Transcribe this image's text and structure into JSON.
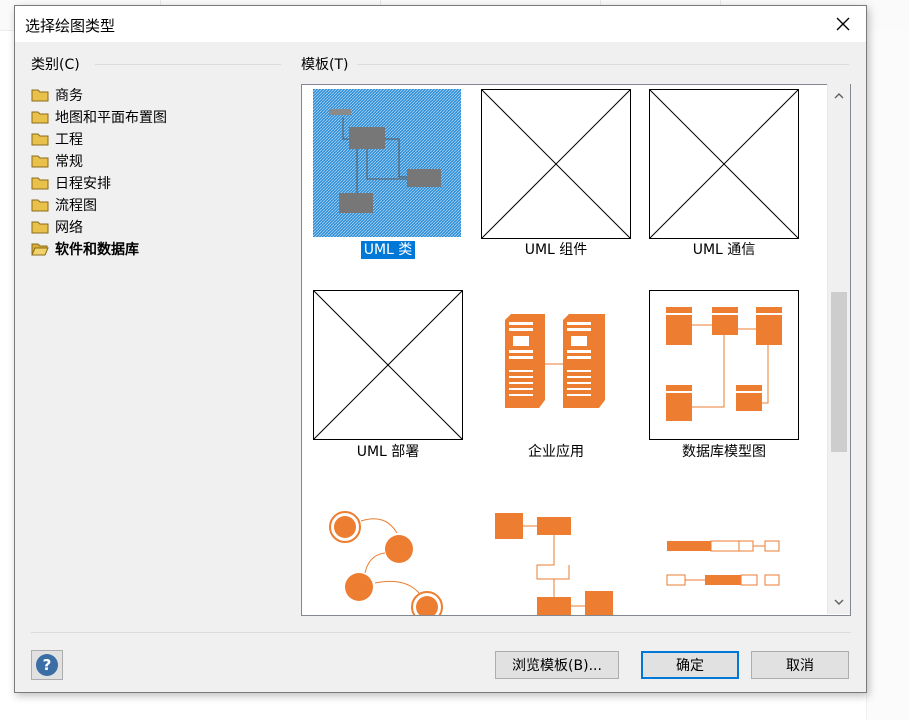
{
  "dialog": {
    "title": "选择绘图类型",
    "close_icon": "close-icon"
  },
  "categories": {
    "label": "类别(C)",
    "items": [
      {
        "label": "商务",
        "selected": false
      },
      {
        "label": "地图和平面布置图",
        "selected": false
      },
      {
        "label": "工程",
        "selected": false
      },
      {
        "label": "常规",
        "selected": false
      },
      {
        "label": "日程安排",
        "selected": false
      },
      {
        "label": "流程图",
        "selected": false
      },
      {
        "label": "网络",
        "selected": false
      },
      {
        "label": "软件和数据库",
        "selected": true
      }
    ]
  },
  "templates": {
    "label": "模板(T)",
    "items": [
      {
        "label": "UML 类",
        "selected": true,
        "thumb": "uml-class-thumbnail"
      },
      {
        "label": "UML 组件",
        "selected": false,
        "thumb": "placeholder-thumbnail"
      },
      {
        "label": "UML 通信",
        "selected": false,
        "thumb": "placeholder-thumbnail"
      },
      {
        "label": "UML 部署",
        "selected": false,
        "thumb": "placeholder-thumbnail"
      },
      {
        "label": "企业应用",
        "selected": false,
        "thumb": "servers-thumbnail"
      },
      {
        "label": "数据库模型图",
        "selected": false,
        "thumb": "database-model-thumbnail"
      },
      {
        "label": "",
        "selected": false,
        "thumb": "state-machine-thumbnail"
      },
      {
        "label": "",
        "selected": false,
        "thumb": "flow-thumbnail"
      },
      {
        "label": "",
        "selected": false,
        "thumb": "sequence-thumbnail"
      }
    ]
  },
  "buttons": {
    "browse": "浏览模板(B)...",
    "ok": "确定",
    "cancel": "取消",
    "help_icon": "help-icon"
  },
  "colors": {
    "accent": "#0078d7",
    "template_orange": "#ed7d31",
    "folder_yellow": "#e8c04a"
  }
}
